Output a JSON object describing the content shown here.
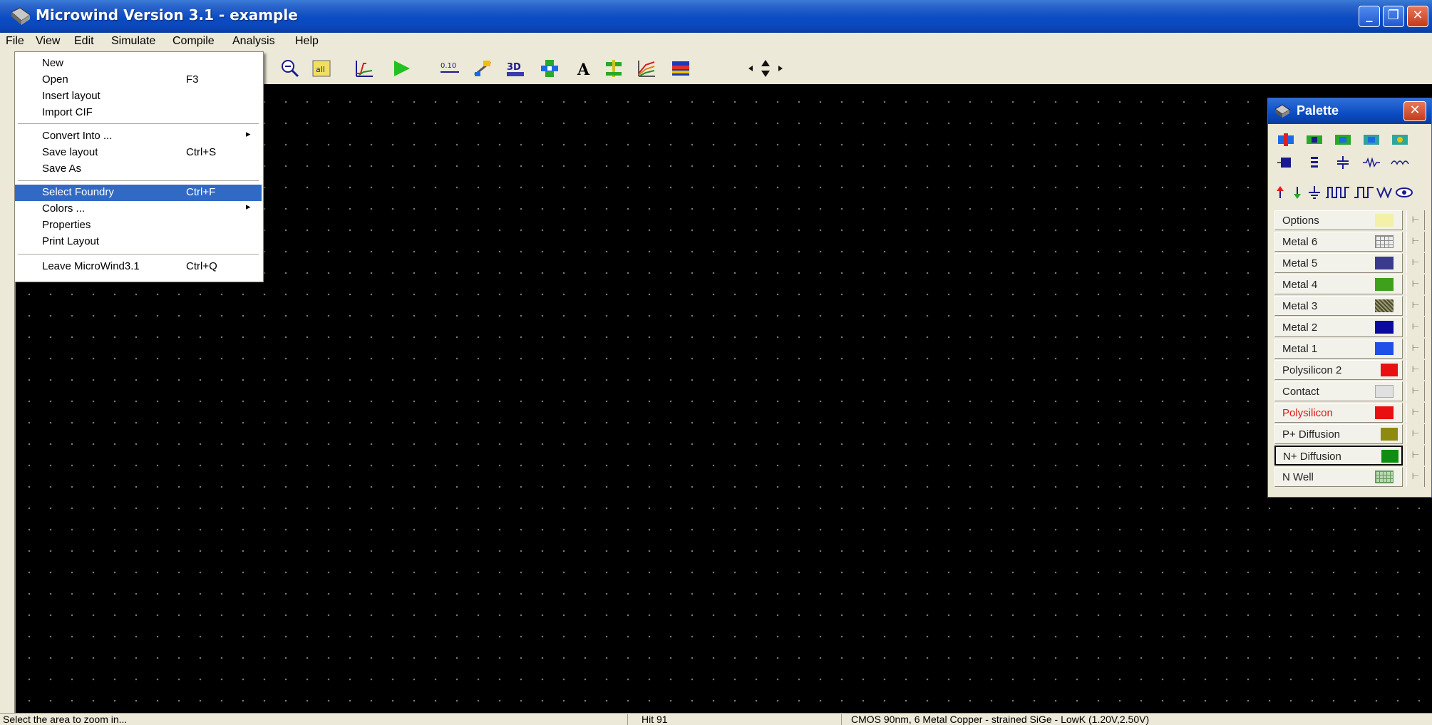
{
  "window": {
    "title": "Microwind Version 3.1 - example",
    "controls": {
      "minimize": "_",
      "maximize": "❐",
      "close": "✕"
    }
  },
  "menubar": {
    "items": [
      "File",
      "View",
      "Edit",
      "Simulate",
      "Compile",
      "Analysis",
      "Help"
    ]
  },
  "file_menu": {
    "items": [
      {
        "label": "New",
        "shortcut": ""
      },
      {
        "label": "Open",
        "shortcut": "F3"
      },
      {
        "label": "Insert layout",
        "shortcut": ""
      },
      {
        "label": "Import CIF",
        "shortcut": ""
      },
      {
        "label": "Convert Into ...",
        "shortcut": "",
        "submenu": "▸"
      },
      {
        "label": "Save layout",
        "shortcut": "Ctrl+S"
      },
      {
        "label": "Save As",
        "shortcut": ""
      },
      {
        "label": "Select Foundry",
        "shortcut": "Ctrl+F"
      },
      {
        "label": "Colors ...",
        "shortcut": "",
        "submenu": "▸"
      },
      {
        "label": "Properties",
        "shortcut": ""
      },
      {
        "label": "Print Layout",
        "shortcut": ""
      },
      {
        "label": "Leave MicroWind3.1",
        "shortcut": "Ctrl+Q"
      }
    ]
  },
  "toolbar": {
    "icons": [
      "zoom-out-icon",
      "view-all-icon",
      "simulation-curve-icon",
      "run-simulation-icon",
      "measure-icon",
      "connection-icon",
      "3d-view-icon",
      "design-rules-icon",
      "text-label-icon",
      "mos-generator-icon",
      "characteristics-icon",
      "layer-view-icon",
      "move-arrows-icon"
    ],
    "view_all_label": "all",
    "measure_label": "0.10",
    "threed_label": "3D",
    "text_label": "A"
  },
  "palette": {
    "title": "Palette",
    "layers": [
      {
        "name": "Options",
        "color": "#f3f0a8"
      },
      {
        "name": "Metal 6",
        "color": "#d8d8d8"
      },
      {
        "name": "Metal 5",
        "color": "#3a3a8e"
      },
      {
        "name": "Metal 4",
        "color": "#3fa01c"
      },
      {
        "name": "Metal 3",
        "color": "#6b6b48"
      },
      {
        "name": "Metal 2",
        "color": "#0a0a9e"
      },
      {
        "name": "Metal 1",
        "color": "#1f4fe8"
      },
      {
        "name": "Polysilicon 2",
        "color": "#e81010"
      },
      {
        "name": "Contact",
        "color": "#d8d8d8"
      },
      {
        "name": "Polysilicon",
        "color": "#e81010"
      },
      {
        "name": "P+ Diffusion",
        "color": "#8e8a10"
      },
      {
        "name": "N+ Diffusion",
        "color": "#108e10"
      },
      {
        "name": "N Well",
        "color": "#b8d8b0"
      }
    ]
  },
  "statusbar": {
    "hint": "Select the area to zoom in...",
    "hit": "Hit 91",
    "technology": "CMOS 90nm, 6 Metal Copper - strained SiGe - LowK (1.20V,2.50V)"
  }
}
